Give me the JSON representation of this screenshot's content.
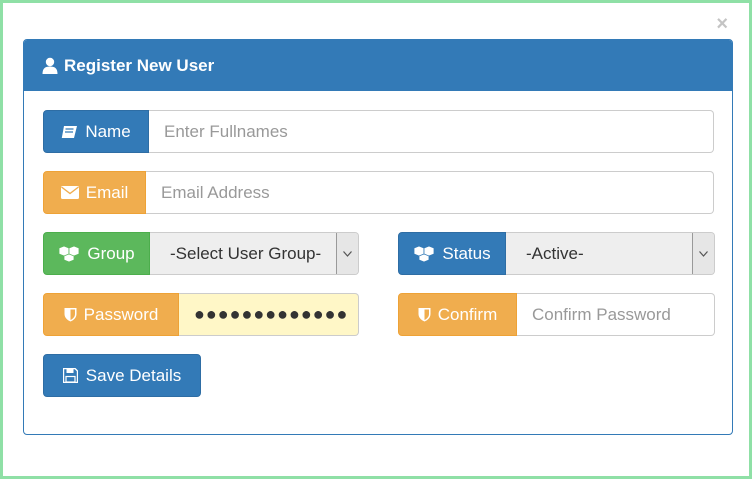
{
  "dialog": {
    "close_label": "×",
    "title": "Register New User",
    "accent": "#337ab7"
  },
  "form": {
    "name": {
      "label": "Name",
      "placeholder": "Enter Fullnames",
      "icon": "book-icon"
    },
    "email": {
      "label": "Email",
      "placeholder": "Email Address",
      "icon": "envelope-icon"
    },
    "group": {
      "label": "Group",
      "selected": "-Select User Group-",
      "icon": "cubes-icon"
    },
    "status": {
      "label": "Status",
      "selected": "-Active-",
      "icon": "cubes-icon"
    },
    "password": {
      "label": "Password",
      "value": "●●●●●●●●●●●●●",
      "icon": "shield-icon"
    },
    "confirm": {
      "label": "Confirm",
      "placeholder": "Confirm Password",
      "icon": "shield-icon"
    },
    "save_label": "Save Details"
  }
}
